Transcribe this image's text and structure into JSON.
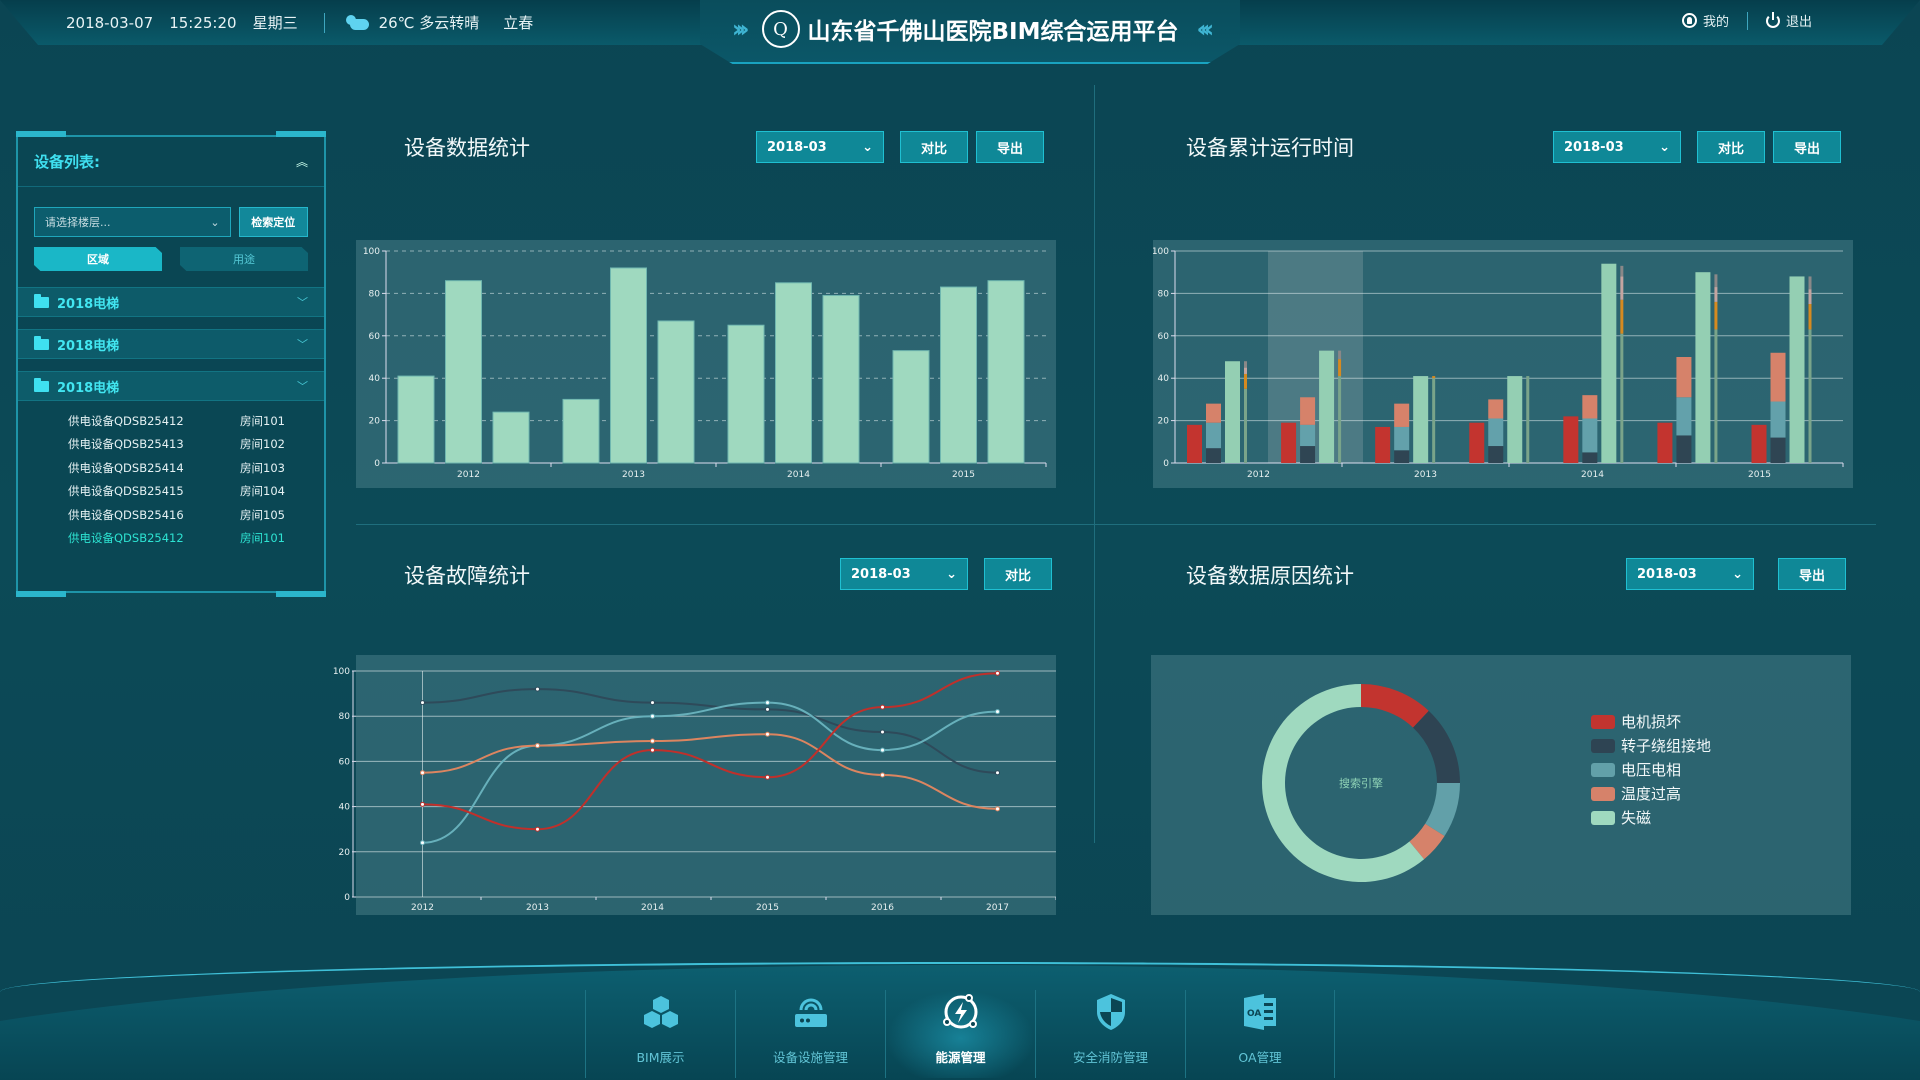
{
  "header": {
    "date": "2018-03-07",
    "time": "15:25:20",
    "weekday": "星期三",
    "weather_icon": "partly-cloudy-icon",
    "weather": "26℃ 多云转晴",
    "solar_term": "立春",
    "title": "山东省千佛山医院BIM综合运用平台",
    "mine_label": "我的",
    "logout_label": "退出"
  },
  "sidebar": {
    "title": "设备列表:",
    "floor_select_placeholder": "请选择楼层...",
    "locate_button": "检索定位",
    "tabs": [
      {
        "label": "区域",
        "active": true
      },
      {
        "label": "用途",
        "active": false
      }
    ],
    "groups": [
      {
        "label": "2018电梯"
      },
      {
        "label": "2018电梯"
      },
      {
        "label": "2018电梯",
        "expanded": true
      }
    ],
    "devices": [
      {
        "code": "供电设备QDSB25412",
        "room": "房间101"
      },
      {
        "code": "供电设备QDSB25413",
        "room": "房间102"
      },
      {
        "code": "供电设备QDSB25414",
        "room": "房间103"
      },
      {
        "code": "供电设备QDSB25415",
        "room": "房间104"
      },
      {
        "code": "供电设备QDSB25416",
        "room": "房间105"
      },
      {
        "code": "供电设备QDSB25412",
        "room": "房间101",
        "selected": true
      }
    ]
  },
  "panels": {
    "stats": {
      "title": "设备数据统计",
      "month": "2018-03",
      "compare": "对比",
      "export": "导出"
    },
    "runtime": {
      "title": "设备累计运行时间",
      "month": "2018-03",
      "compare": "对比",
      "export": "导出"
    },
    "faults": {
      "title": "设备故障统计",
      "month": "2018-03",
      "compare": "对比"
    },
    "causes": {
      "title": "设备数据原因统计",
      "month": "2018-03",
      "export": "导出"
    }
  },
  "chart_data": [
    {
      "type": "bar",
      "title": "设备数据统计",
      "categories": [
        "2012",
        "2013",
        "2014",
        "2015"
      ],
      "values": [
        41,
        86,
        24,
        30,
        92,
        67,
        65,
        85,
        79,
        53,
        83,
        86
      ],
      "bars_per_category": 3,
      "ylim": [
        0,
        100
      ],
      "yticks": [
        0,
        20,
        40,
        60,
        80,
        100
      ],
      "grid": true,
      "color": "#9fd9bf"
    },
    {
      "type": "bar",
      "title": "设备累计运行时间",
      "categories": [
        "2012",
        "2013",
        "2014",
        "2015"
      ],
      "ylim": [
        0,
        100
      ],
      "yticks": [
        0,
        20,
        40,
        60,
        80,
        100
      ],
      "groups": [
        {
          "red": 18,
          "stack": [
            7,
            12,
            9
          ],
          "green": 48,
          "thin": [
            35,
            7,
            3,
            3
          ]
        },
        {
          "red": 19,
          "stack": [
            8,
            10,
            13
          ],
          "green": 53,
          "thin": [
            41,
            8,
            0,
            4
          ]
        },
        {
          "red": 17,
          "stack": [
            6,
            11,
            11
          ],
          "green": 41,
          "thin": [
            40,
            1,
            0,
            0
          ]
        },
        {
          "red": 19,
          "stack": [
            8,
            13,
            9
          ],
          "green": 41,
          "thin": [
            41,
            0,
            0,
            0
          ]
        },
        {
          "red": 22,
          "stack": [
            5,
            16,
            11
          ],
          "green": 94,
          "thin": [
            61,
            16,
            11,
            5
          ]
        },
        {
          "red": 19,
          "stack": [
            13,
            18,
            19
          ],
          "green": 90,
          "thin": [
            63,
            13,
            7,
            6
          ]
        },
        {
          "red": 18,
          "stack": [
            12,
            17,
            23
          ],
          "green": 88,
          "thin": [
            63,
            12,
            7,
            6
          ]
        }
      ],
      "stack_colors": [
        "#2f4553",
        "#63a1ab",
        "#d6826a"
      ],
      "thin_colors": [
        "#7aa48a",
        "#d68a20",
        "#c4a4a0",
        "#8a8888"
      ],
      "red_color": "#c3342f",
      "green_color": "#94cfb3"
    },
    {
      "type": "line",
      "title": "设备故障统计",
      "x": [
        "2012",
        "2013",
        "2014",
        "2015",
        "2016",
        "2017"
      ],
      "ylim": [
        0,
        100
      ],
      "yticks": [
        0,
        20,
        40,
        60,
        80,
        100
      ],
      "series": [
        {
          "name": "dark",
          "color": "#2e4a5a",
          "values": [
            86,
            92,
            86,
            83,
            73,
            55
          ]
        },
        {
          "name": "teal",
          "color": "#67b0bb",
          "values": [
            24,
            67,
            80,
            86,
            65,
            82
          ]
        },
        {
          "name": "orange",
          "color": "#dc8560",
          "values": [
            55,
            67,
            69,
            72,
            54,
            39
          ]
        },
        {
          "name": "red",
          "color": "#c0302b",
          "values": [
            41,
            30,
            65,
            53,
            84,
            99
          ]
        }
      ]
    },
    {
      "type": "pie",
      "title": "设备数据原因统计",
      "center_label": "搜索引擎",
      "legend_position": "right",
      "slices": [
        {
          "label": "电机损坏",
          "value": 12,
          "color": "#c2342f"
        },
        {
          "label": "转子绕组接地",
          "value": 13,
          "color": "#2e4453"
        },
        {
          "label": "电压电相",
          "value": 9,
          "color": "#62a0a9"
        },
        {
          "label": "温度过高",
          "value": 5,
          "color": "#d6826a"
        },
        {
          "label": "失磁",
          "value": 61,
          "color": "#9fd9bf"
        }
      ]
    }
  ],
  "nav": [
    {
      "label": "BIM展示",
      "icon": "cubes-icon"
    },
    {
      "label": "设备设施管理",
      "icon": "router-icon"
    },
    {
      "label": "能源管理",
      "icon": "energy-icon",
      "active": true
    },
    {
      "label": "安全消防管理",
      "icon": "shield-icon"
    },
    {
      "label": "OA管理",
      "icon": "oa-icon"
    }
  ]
}
